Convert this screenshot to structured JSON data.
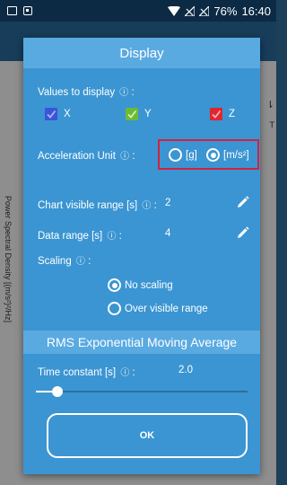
{
  "status_bar": {
    "battery": "76%",
    "time": "16:40"
  },
  "background": {
    "y_axis_label": "Power Spectral Density [(m/s²)²/Hz]"
  },
  "dialog": {
    "title": "Display",
    "values_to_display": {
      "label": "Values to display",
      "info_icon": "ⓘ",
      "suffix": ":",
      "items": [
        {
          "label": "X",
          "checked": true,
          "color": "#3b55d8"
        },
        {
          "label": "Y",
          "checked": true,
          "color": "#6dbb34"
        },
        {
          "label": "Z",
          "checked": true,
          "color": "#e0262f"
        }
      ]
    },
    "acceleration_unit": {
      "label": "Acceleration Unit",
      "info_icon": "ⓘ",
      "suffix": ":",
      "options": [
        {
          "label": "[g]",
          "selected": false
        },
        {
          "label": "[m/s²]",
          "selected": true
        }
      ]
    },
    "chart_visible_range": {
      "label": "Chart visible range [s]",
      "info_icon": "ⓘ",
      "suffix": ":",
      "value": "2"
    },
    "data_range": {
      "label": "Data range [s]",
      "info_icon": "ⓘ",
      "suffix": ":",
      "value": "4"
    },
    "scaling": {
      "label": "Scaling",
      "info_icon": "ⓘ",
      "suffix": ":",
      "options": [
        {
          "label": "No scaling",
          "selected": true
        },
        {
          "label": "Over visible range",
          "selected": false
        }
      ]
    },
    "rms_section_title": "RMS Exponential Moving Average",
    "time_constant": {
      "label": "Time constant [s]",
      "info_icon": "ⓘ",
      "suffix": ":",
      "value": "2.0",
      "slider_fraction": 0.1
    },
    "ok_label": "OK"
  },
  "colors": {
    "dialog_bg": "#3b95d2",
    "header_bg": "#5aaae2",
    "highlight_border": "#d2233a"
  }
}
